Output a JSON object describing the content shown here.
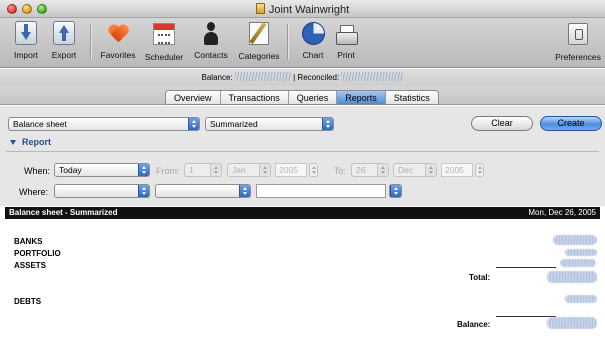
{
  "window": {
    "title": "Joint Wainwright"
  },
  "toolbar": {
    "items": [
      {
        "label": "Import",
        "icon": "import-icon"
      },
      {
        "label": "Export",
        "icon": "export-icon"
      },
      {
        "label": "Favorites",
        "icon": "favorites-heart-icon"
      },
      {
        "label": "Scheduler",
        "icon": "scheduler-calendar-icon"
      },
      {
        "label": "Contacts",
        "icon": "contacts-person-icon"
      },
      {
        "label": "Categories",
        "icon": "categories-pencil-icon"
      },
      {
        "label": "Chart",
        "icon": "chart-pie-icon"
      },
      {
        "label": "Print",
        "icon": "printer-icon"
      },
      {
        "label": "Preferences",
        "icon": "preferences-icon"
      }
    ]
  },
  "balance": {
    "balance_label": "Balance:",
    "reconciled_label": "| Reconciled:"
  },
  "tabs": [
    {
      "label": "Overview",
      "active": false
    },
    {
      "label": "Transactions",
      "active": false
    },
    {
      "label": "Queries",
      "active": false
    },
    {
      "label": "Reports",
      "active": true
    },
    {
      "label": "Statistics",
      "active": false
    }
  ],
  "controls": {
    "report_type": "Balance sheet",
    "report_mode": "Summarized",
    "clear_label": "Clear",
    "create_label": "Create",
    "report_section": "Report"
  },
  "filters": {
    "when_label": "When:",
    "when_value": "Today",
    "from_label": "From:",
    "from_day": "1",
    "from_month": "Jan",
    "from_year": "2005",
    "to_label": "To:",
    "to_day": "26",
    "to_month": "Dec",
    "to_year": "2005",
    "where_label": "Where:",
    "where_field_1": "",
    "where_field_2": "",
    "where_text": ""
  },
  "report": {
    "header_title": "Balance sheet - Summarized",
    "header_date": "Mon, Dec 26, 2005",
    "rows": [
      "BANKS",
      "PORTFOLIO",
      "ASSETS",
      "DEBTS"
    ],
    "total_label": "Total:",
    "balance_label": "Balance:"
  },
  "colors": {
    "accent_blue": "#4f8ad8",
    "header_black": "#111111",
    "section_blue": "#2b4f8c"
  }
}
